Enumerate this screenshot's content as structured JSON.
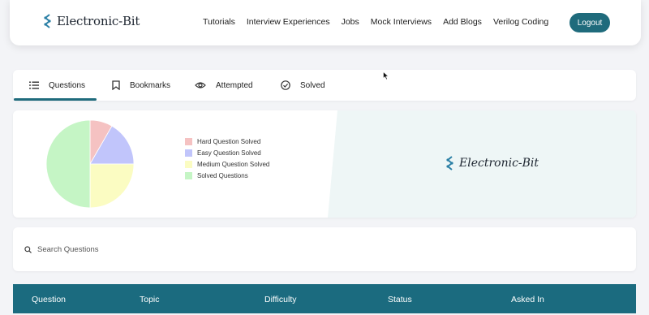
{
  "brand": {
    "name": "Electronic-Bit"
  },
  "nav": {
    "links": [
      "Tutorials",
      "Interview Experiences",
      "Jobs",
      "Mock Interviews",
      "Add Blogs",
      "Verilog Coding"
    ],
    "logout_label": "Logout"
  },
  "tabs": [
    {
      "label": "Questions",
      "icon": "list-icon",
      "active": true
    },
    {
      "label": "Bookmarks",
      "icon": "bookmark-icon"
    },
    {
      "label": "Attempted",
      "icon": "eye-icon"
    },
    {
      "label": "Solved",
      "icon": "check-circle-icon"
    }
  ],
  "chart_data": {
    "type": "pie",
    "legend_position": "right",
    "categories": [
      "Hard Question Solved",
      "Easy Question Solved",
      "Medium Question Solved",
      "Solved Questions"
    ],
    "values": [
      5,
      10,
      15,
      30
    ],
    "colors": [
      "#f5c2c2",
      "#c1c5fb",
      "#fbfcc2",
      "#c5f5c5"
    ]
  },
  "stats_logo": {
    "name": "Electronic-Bit"
  },
  "search": {
    "placeholder": "Search Questions",
    "value": ""
  },
  "table": {
    "columns": [
      "Question",
      "Topic",
      "Difficulty",
      "Status",
      "Asked In"
    ]
  },
  "colors": {
    "accent": "#1f6b7c",
    "table_header": "#1b6b7f"
  }
}
